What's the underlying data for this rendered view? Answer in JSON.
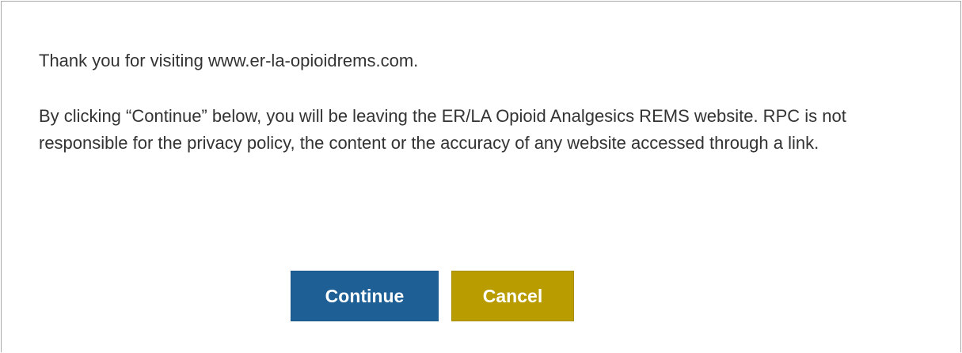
{
  "dialog": {
    "intro_text": "Thank you for visiting www.er-la-opioidrems.com.",
    "disclaimer_text": "By clicking “Continue” below, you will be leaving the ER/LA Opioid Analgesics REMS website. RPC is not responsible for the privacy policy, the content or the accuracy of any website accessed through a link.",
    "continue_label": "Continue",
    "cancel_label": "Cancel"
  },
  "colors": {
    "continue_button": "#1e5f96",
    "cancel_button": "#b89c00",
    "text": "#333333",
    "border": "#a9a9a9"
  }
}
